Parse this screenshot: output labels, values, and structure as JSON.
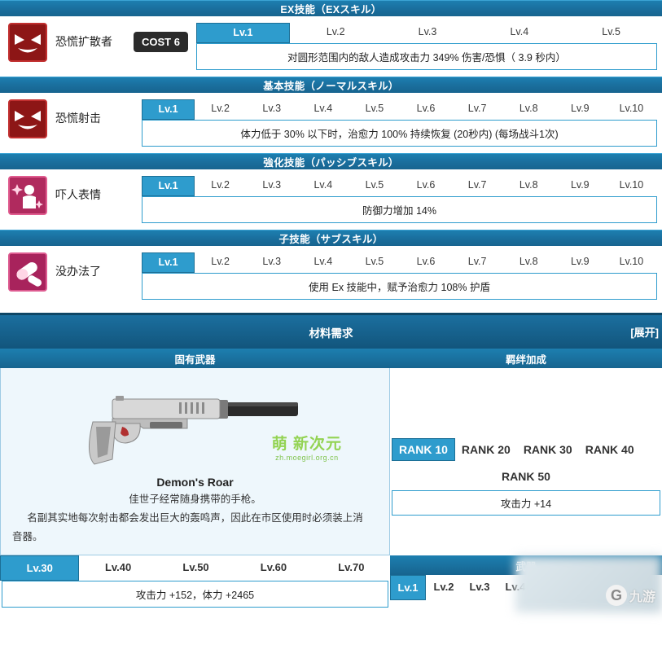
{
  "sections": {
    "ex": "EX技能（EXスキル）",
    "basic": "基本技能（ノーマルスキル）",
    "passive": "強化技能（パッシブスキル）",
    "sub": "子技能（サブスキル）"
  },
  "ex_skill": {
    "name": "恐慌扩散者",
    "cost": "COST 6",
    "levels": [
      "Lv.1",
      "Lv.2",
      "Lv.3",
      "Lv.4",
      "Lv.5"
    ],
    "active_index": 0,
    "desc": "对圆形范围内的敌人造成攻击力 349% 伤害/恐惧（ 3.9 秒内）"
  },
  "basic_skill": {
    "name": "恐慌射击",
    "levels": [
      "Lv.1",
      "Lv.2",
      "Lv.3",
      "Lv.4",
      "Lv.5",
      "Lv.6",
      "Lv.7",
      "Lv.8",
      "Lv.9",
      "Lv.10"
    ],
    "active_index": 0,
    "desc": "体力低于 30% 以下时，治愈力 100% 持续恢复 (20秒内) (每场战斗1次)"
  },
  "passive_skill": {
    "name": "吓人表情",
    "levels": [
      "Lv.1",
      "Lv.2",
      "Lv.3",
      "Lv.4",
      "Lv.5",
      "Lv.6",
      "Lv.7",
      "Lv.8",
      "Lv.9",
      "Lv.10"
    ],
    "active_index": 0,
    "desc": "防御力增加 14%"
  },
  "sub_skill": {
    "name": "没办法了",
    "levels": [
      "Lv.1",
      "Lv.2",
      "Lv.3",
      "Lv.4",
      "Lv.5",
      "Lv.6",
      "Lv.7",
      "Lv.8",
      "Lv.9",
      "Lv.10"
    ],
    "active_index": 0,
    "desc": "使用 Ex 技能中，赋予治愈力 108% 护盾"
  },
  "materials": {
    "title": "材料需求",
    "expand": "[展开]"
  },
  "weapon": {
    "col_title": "固有武器",
    "name": "Demon's Roar",
    "desc_line1": "佳世子经常随身携带的手枪。",
    "desc_line2": "名副其实地每次射击都会发出巨大的轰鸣声，因此在市区使用时必须装上消",
    "desc_line3": "音器。",
    "watermark_main": "萌 新次元",
    "watermark_sub": "zh.moegirl.org.cn",
    "level_tabs": [
      "Lv.30",
      "Lv.40",
      "Lv.50",
      "Lv.60",
      "Lv.70"
    ],
    "level_active_index": 0,
    "level_value": "攻击力 +152，体力 +2465"
  },
  "bond": {
    "col_title": "羁绊加成",
    "ranks_row1": [
      "RANK 10",
      "RANK 20",
      "RANK 30",
      "RANK 40"
    ],
    "ranks_row2": [
      "RANK 50"
    ],
    "active_rank": "RANK 10",
    "value": "攻击力 +14"
  },
  "weapon_right": {
    "col_title": "武器",
    "level_tabs": [
      "Lv.1",
      "Lv.2",
      "Lv.3",
      "Lv.4"
    ],
    "level_active_index": 0
  },
  "branding": {
    "nine_game": "九游"
  },
  "colors": {
    "accent": "#2e9ccd",
    "bar": "#17648f",
    "skill_red": "#8d1616",
    "skill_pink": "#b02a5e"
  }
}
